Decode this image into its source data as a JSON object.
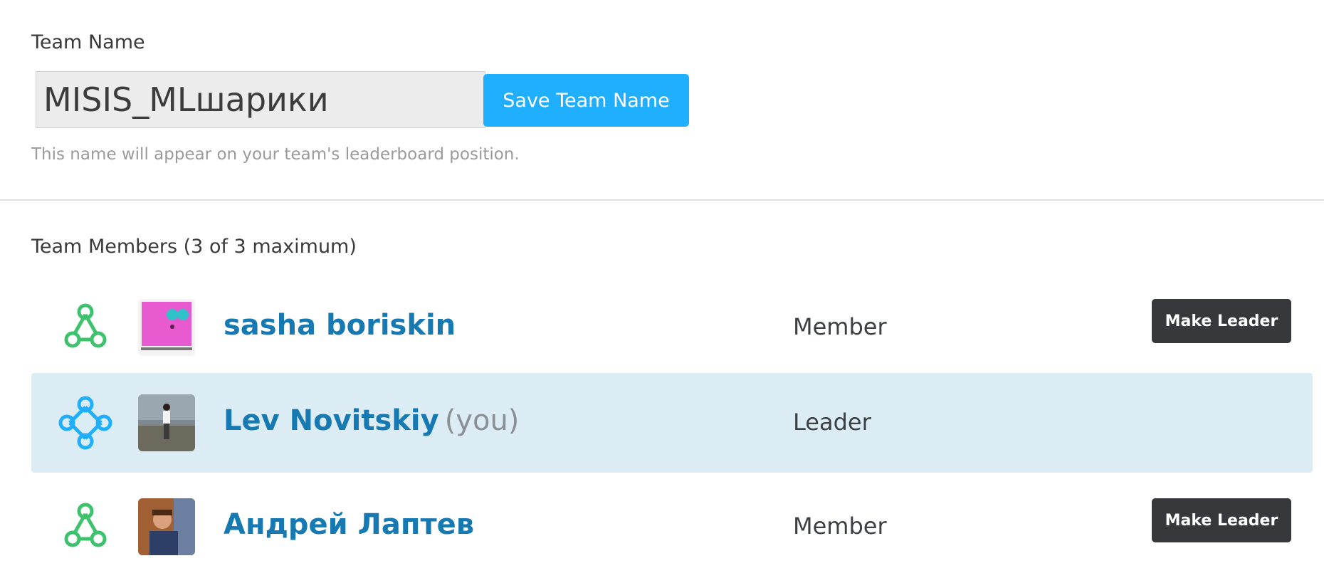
{
  "team_name": {
    "label": "Team Name",
    "value": "MISIS_MLшарики",
    "save_label": "Save Team Name",
    "help_text": "This name will appear on your team's leaderboard position."
  },
  "members": {
    "heading": "Team Members (3 of 3 maximum)",
    "list": [
      {
        "name": "sasha boriskin",
        "you_tag": "",
        "role": "Member",
        "action_label": "Make Leader",
        "icon": "member-network-icon",
        "icon_color": "#3fc26e"
      },
      {
        "name": "Lev Novitskiy",
        "you_tag": "(you)",
        "role": "Leader",
        "action_label": "",
        "icon": "leader-diamond-icon",
        "icon_color": "#20aeff"
      },
      {
        "name": "Андрей Лаптев",
        "you_tag": "",
        "role": "Member",
        "action_label": "Make Leader",
        "icon": "member-network-icon",
        "icon_color": "#3fc26e"
      }
    ]
  },
  "colors": {
    "accent": "#20aeff",
    "link": "#1679b2",
    "highlight_row": "#dbecf4",
    "dark_button": "#37383c"
  }
}
